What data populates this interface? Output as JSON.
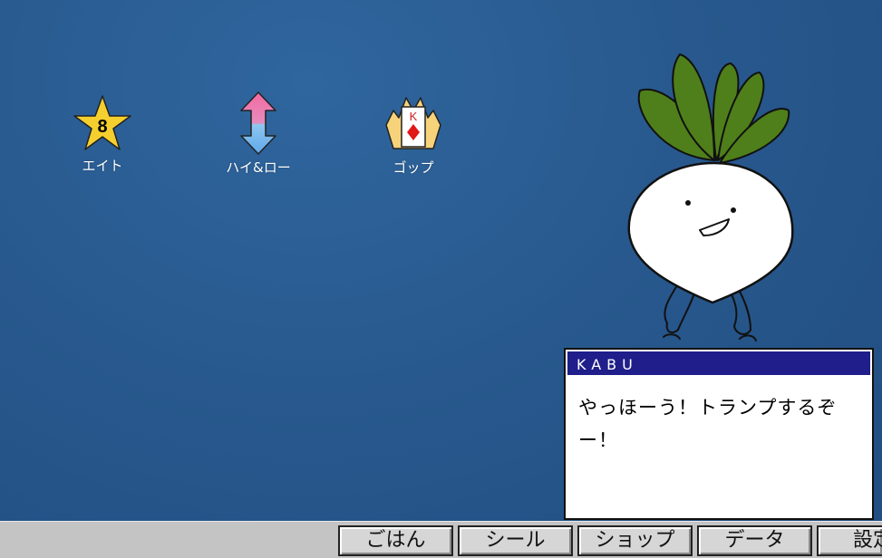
{
  "desktop": {
    "icons": [
      {
        "label": "エイト",
        "badge": "8",
        "icon": "star-icon"
      },
      {
        "label": "ハイ&ロー",
        "icon": "up-down-arrow-icon"
      },
      {
        "label": "ゴップ",
        "card_rank": "K",
        "icon": "king-card-icon"
      }
    ]
  },
  "dialog": {
    "speaker": "KABU",
    "message": "やっほーう！トランプするぞー！"
  },
  "taskbar": {
    "buttons": [
      "ごはん",
      "シール",
      "ショップ",
      "データ",
      "設定"
    ]
  },
  "colors": {
    "desktop_bg": "#28598e",
    "dialog_title_bg": "#1f1e8a",
    "taskbar_bg": "#c4c4c4",
    "leaf_green": "#4f7f1a"
  }
}
